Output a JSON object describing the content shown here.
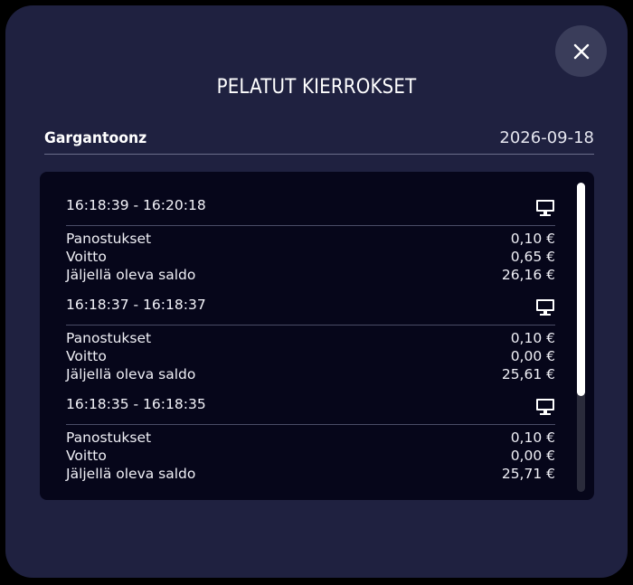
{
  "dialog": {
    "title": "PELATUT KIERROKSET",
    "close_icon": "close-icon"
  },
  "game": {
    "name": "Gargantoonz",
    "date": "2026-09-18"
  },
  "rounds": [
    {
      "time": "16:18:39 - 16:20:18",
      "icon": "desktop-icon",
      "bet_label": "Panostukset",
      "bet_value": "0,10 €",
      "win_label": "Voitto",
      "win_value": "0,65 €",
      "balance_label": "Jäljellä oleva saldo",
      "balance_value": "26,16 €"
    },
    {
      "time": "16:18:37 - 16:18:37",
      "icon": "desktop-icon",
      "bet_label": "Panostukset",
      "bet_value": "0,10 €",
      "win_label": "Voitto",
      "win_value": "0,00 €",
      "balance_label": "Jäljellä oleva saldo",
      "balance_value": "25,61 €"
    },
    {
      "time": "16:18:35 - 16:18:35",
      "icon": "desktop-icon",
      "bet_label": "Panostukset",
      "bet_value": "0,10 €",
      "win_label": "Voitto",
      "win_value": "0,00 €",
      "balance_label": "Jäljellä oleva saldo",
      "balance_value": "25,71 €"
    }
  ],
  "colors": {
    "modal_bg": "#1f2140",
    "panel_bg": "#06061a",
    "text": "#ffffff",
    "close_button_bg": "#3a3d5a"
  }
}
